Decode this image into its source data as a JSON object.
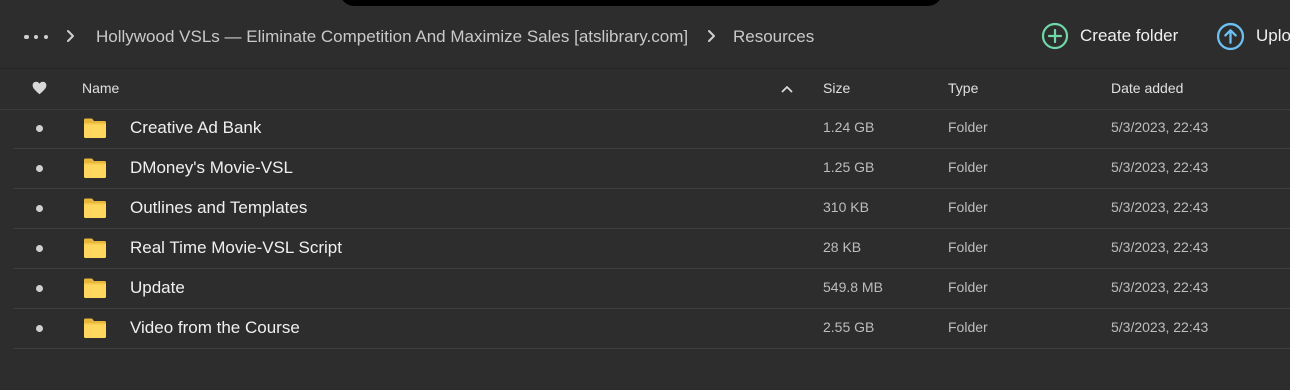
{
  "breadcrumb": {
    "items": [
      "Hollywood VSLs — Eliminate Competition And Maximize Sales [atslibrary.com]",
      "Resources"
    ]
  },
  "actions": {
    "create_folder": "Create folder",
    "upload": "Uplo"
  },
  "table": {
    "columns": {
      "name": "Name",
      "size": "Size",
      "type": "Type",
      "date": "Date added"
    },
    "sort": {
      "column": "name",
      "direction": "ascending"
    },
    "rows": [
      {
        "name": "Creative Ad Bank",
        "size": "1.24 GB",
        "type": "Folder",
        "date": "5/3/2023, 22:43"
      },
      {
        "name": "DMoney's Movie-VSL",
        "size": "1.25 GB",
        "type": "Folder",
        "date": "5/3/2023, 22:43"
      },
      {
        "name": "Outlines and Templates",
        "size": "310 KB",
        "type": "Folder",
        "date": "5/3/2023, 22:43"
      },
      {
        "name": "Real Time Movie-VSL Script",
        "size": "28 KB",
        "type": "Folder",
        "date": "5/3/2023, 22:43"
      },
      {
        "name": "Update",
        "size": "549.8 MB",
        "type": "Folder",
        "date": "5/3/2023, 22:43"
      },
      {
        "name": "Video from the Course",
        "size": "2.55 GB",
        "type": "Folder",
        "date": "5/3/2023, 22:43"
      }
    ]
  },
  "colors": {
    "background": "#2d2d2d",
    "create_folder_icon": "#6fd7a8",
    "upload_icon": "#6cc1f2",
    "folder_body": "#ffd75e",
    "folder_tab": "#e8b73b"
  },
  "icons": {
    "more": "more-icon",
    "breadcrumb_separator": "chevron-right-icon",
    "create_folder": "plus-circle-icon",
    "upload": "arrow-up-circle-icon",
    "favorite": "heart-icon",
    "sort": "chevron-up-icon",
    "folder": "folder-icon"
  }
}
